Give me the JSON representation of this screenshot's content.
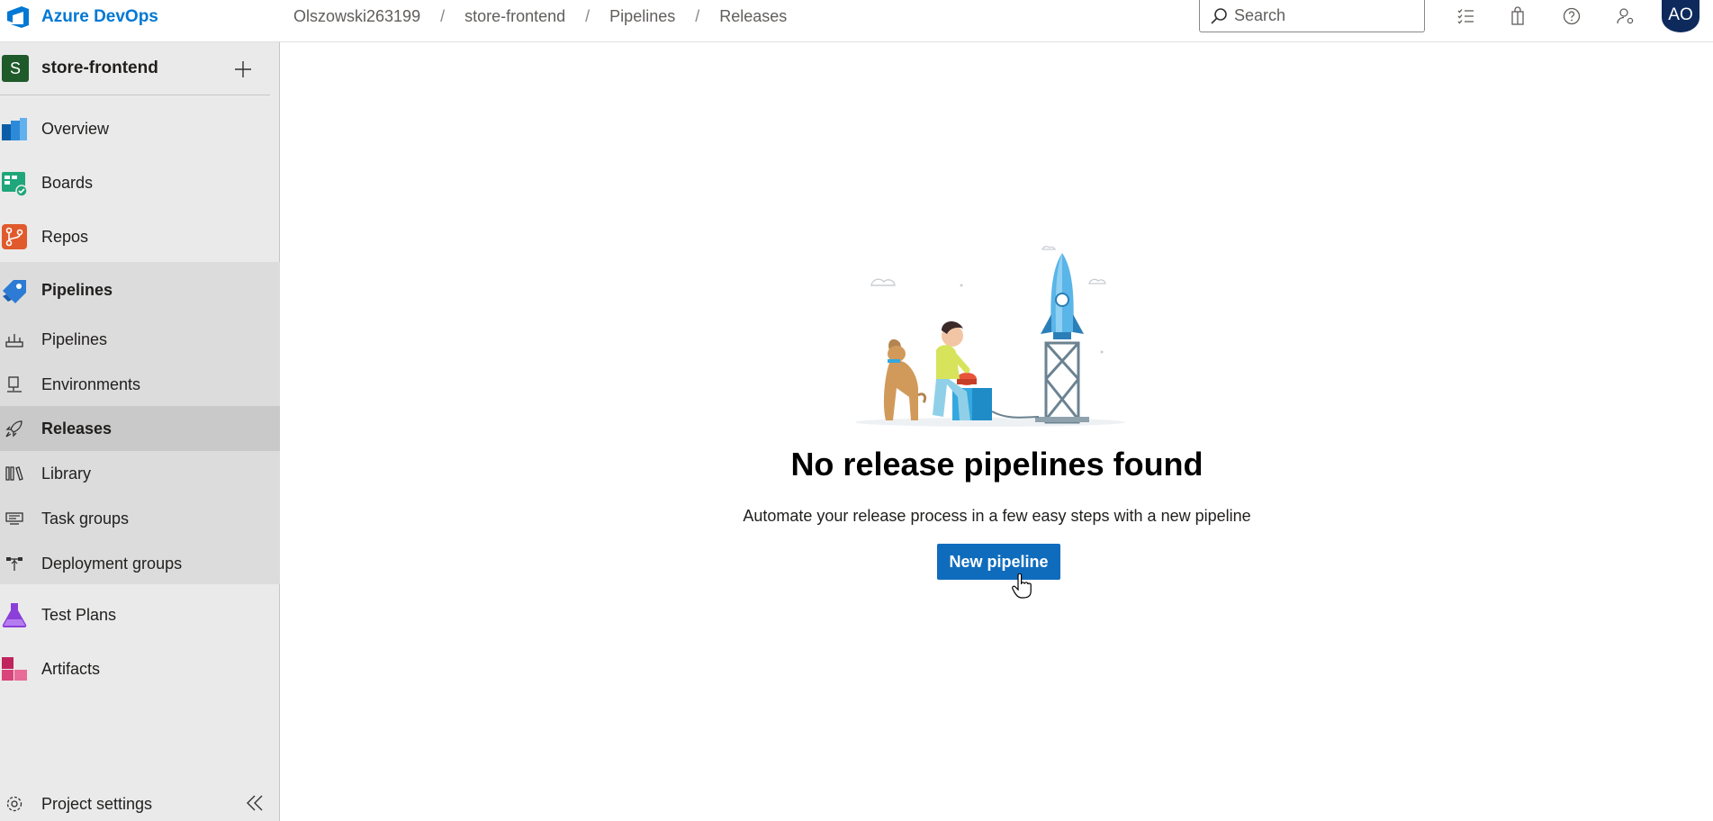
{
  "header": {
    "brand": "Azure DevOps",
    "breadcrumb": [
      "Olszowski263199",
      "store-frontend",
      "Pipelines",
      "Releases"
    ],
    "breadcrumb_sep": "/",
    "search_placeholder": "Search",
    "avatar_initials": "AO",
    "icons": [
      "task-list-icon",
      "shopping-bag-icon",
      "help-icon",
      "user-settings-icon"
    ]
  },
  "sidebar": {
    "project_initial": "S",
    "project_name": "store-frontend",
    "items": [
      {
        "label": "Overview",
        "icon": "overview-icon"
      },
      {
        "label": "Boards",
        "icon": "boards-icon"
      },
      {
        "label": "Repos",
        "icon": "repos-icon"
      },
      {
        "label": "Pipelines",
        "icon": "pipelines-icon"
      },
      {
        "label": "Pipelines",
        "icon": "pipelines-sub-icon"
      },
      {
        "label": "Environments",
        "icon": "environments-icon"
      },
      {
        "label": "Releases",
        "icon": "releases-icon"
      },
      {
        "label": "Library",
        "icon": "library-icon"
      },
      {
        "label": "Task groups",
        "icon": "task-groups-icon"
      },
      {
        "label": "Deployment groups",
        "icon": "deployment-groups-icon"
      },
      {
        "label": "Test Plans",
        "icon": "test-plans-icon"
      },
      {
        "label": "Artifacts",
        "icon": "artifacts-icon"
      }
    ],
    "settings_label": "Project settings"
  },
  "main": {
    "title": "No release pipelines found",
    "subtitle": "Automate your release process in a few easy steps with a new pipeline",
    "button_label": "New pipeline"
  },
  "colors": {
    "brand": "#0078d4",
    "primary_button": "#0f6cbd",
    "sidebar_bg": "#eaeaea",
    "avatar_bg": "#0e2a5c"
  }
}
